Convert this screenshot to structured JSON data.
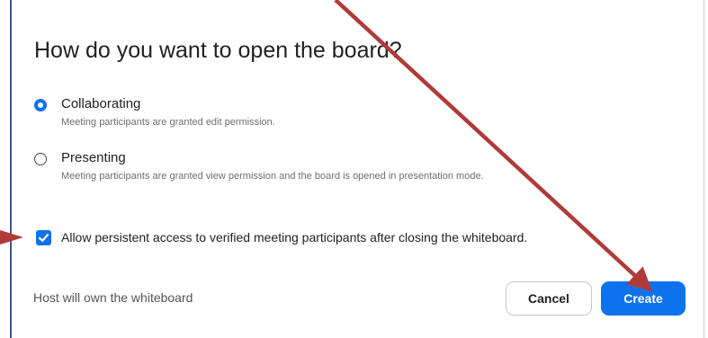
{
  "dialog": {
    "title": "How do you want to open the board?"
  },
  "options": [
    {
      "label": "Collaborating",
      "description": "Meeting participants are granted edit permission.",
      "selected": true
    },
    {
      "label": "Presenting",
      "description": "Meeting participants are granted view permission and the board is opened in presentation mode.",
      "selected": false
    }
  ],
  "persistent_access": {
    "label": "Allow persistent access to verified meeting participants after closing the whiteboard.",
    "checked": true
  },
  "footer": {
    "owner_text": "Host will own the whiteboard",
    "cancel_label": "Cancel",
    "create_label": "Create"
  },
  "icons": {
    "check": "check-icon",
    "annotation": "arrow-icon"
  },
  "colors": {
    "accent": "#0e72ed",
    "annotation_arrow": "#b03a3a"
  }
}
